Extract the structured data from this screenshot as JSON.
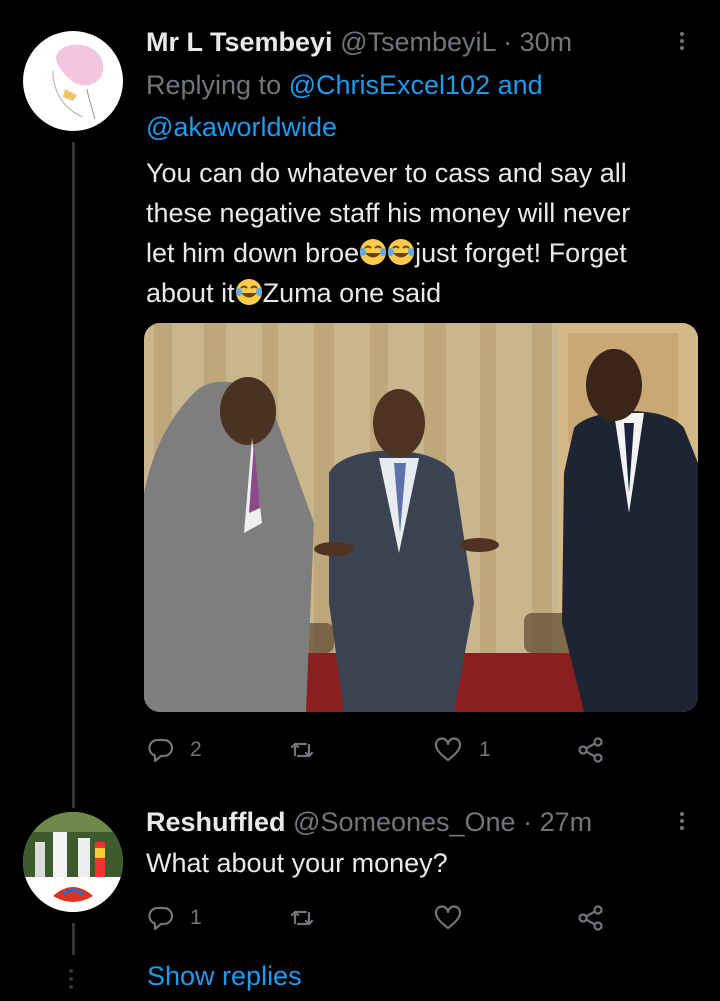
{
  "tweet": {
    "display_name": "Mr L Tsembeyi",
    "handle": "@TsembeyiL",
    "separator": "·",
    "time": "30m",
    "replying_prefix": "Replying to",
    "reply_to_1": "@ChrisExcel102",
    "reply_joiner": "and",
    "reply_to_2": "@akaworldwide",
    "text_line_1": "You can do whatever to cass and say all",
    "text_line_2": "these negative staff his money will never",
    "text_line_3_a": "let him down broe",
    "text_line_3_b": "just forget! Forget",
    "text_line_4_a": "about it",
    "text_line_4_b": "Zuma one said",
    "emoji": "face-with-tears-of-joy",
    "reply_count": "2",
    "retweet_count": "",
    "like_count": "1"
  },
  "reply": {
    "display_name": "Reshuffled",
    "handle": "@Someones_One",
    "separator": "·",
    "time": "27m",
    "text": "What about your money?",
    "reply_count": "1",
    "retweet_count": "",
    "like_count": ""
  },
  "show_replies_label": "Show replies",
  "colors": {
    "background": "#000000",
    "link": "#1d9bf0",
    "muted": "#71767b",
    "text": "#e7e9ea"
  }
}
